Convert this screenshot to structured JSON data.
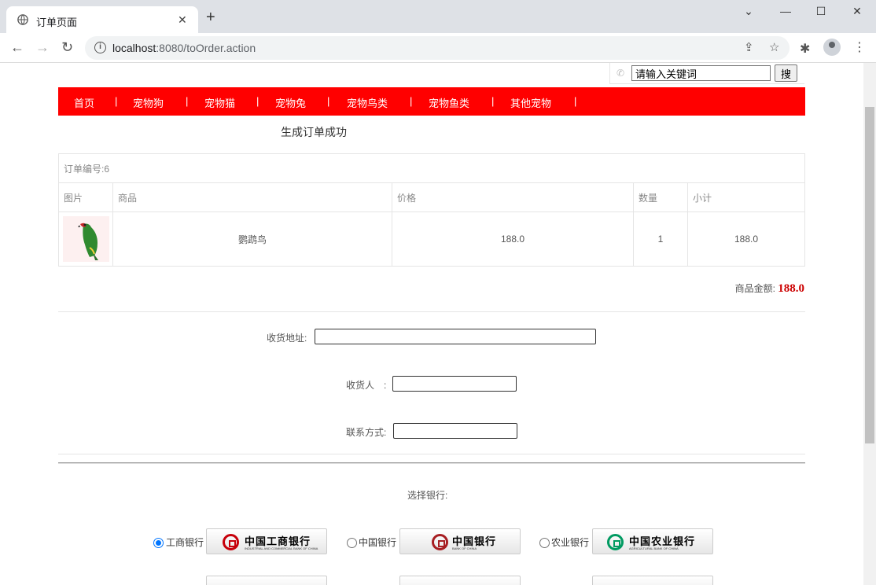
{
  "browser": {
    "tab_title": "订单页面",
    "url_host": "localhost",
    "url_rest": ":8080/toOrder.action"
  },
  "search": {
    "value": "请输入关键词",
    "button_label": "搜"
  },
  "nav": {
    "items": [
      "首页",
      "宠物狗",
      "宠物猫",
      "宠物兔",
      "宠物鸟类",
      "宠物鱼类",
      "其他宠物"
    ],
    "separator": "|"
  },
  "order": {
    "success_message": "生成订单成功",
    "order_no_label": "订单编号:6",
    "columns": [
      "图片",
      "商品",
      "价格",
      "数量",
      "小计"
    ],
    "items": [
      {
        "name": "鹦鹉鸟",
        "price": "188.0",
        "quantity": "1",
        "subtotal": "188.0"
      }
    ],
    "total_label": "商品金额:",
    "total_value": "188.0"
  },
  "form": {
    "address_label": "收货地址:",
    "receiver_label": "收货人　:",
    "phone_label": "联系方式:"
  },
  "banks": {
    "title": "选择银行:",
    "options": [
      {
        "label": "工商银行",
        "logo_name": "中国工商银行",
        "logo_en": "INDUSTRIAL AND COMMERCIAL BANK OF CHINA",
        "color": "#c7000b",
        "checked": true
      },
      {
        "label": "中国银行",
        "logo_name": "中国银行",
        "logo_en": "BANK OF CHINA",
        "color": "#a71e22",
        "checked": false
      },
      {
        "label": "农业银行",
        "logo_name": "中国农业银行",
        "logo_en": "AGRICULTURAL BANK OF CHINA",
        "color": "#009a61",
        "checked": false
      }
    ]
  }
}
